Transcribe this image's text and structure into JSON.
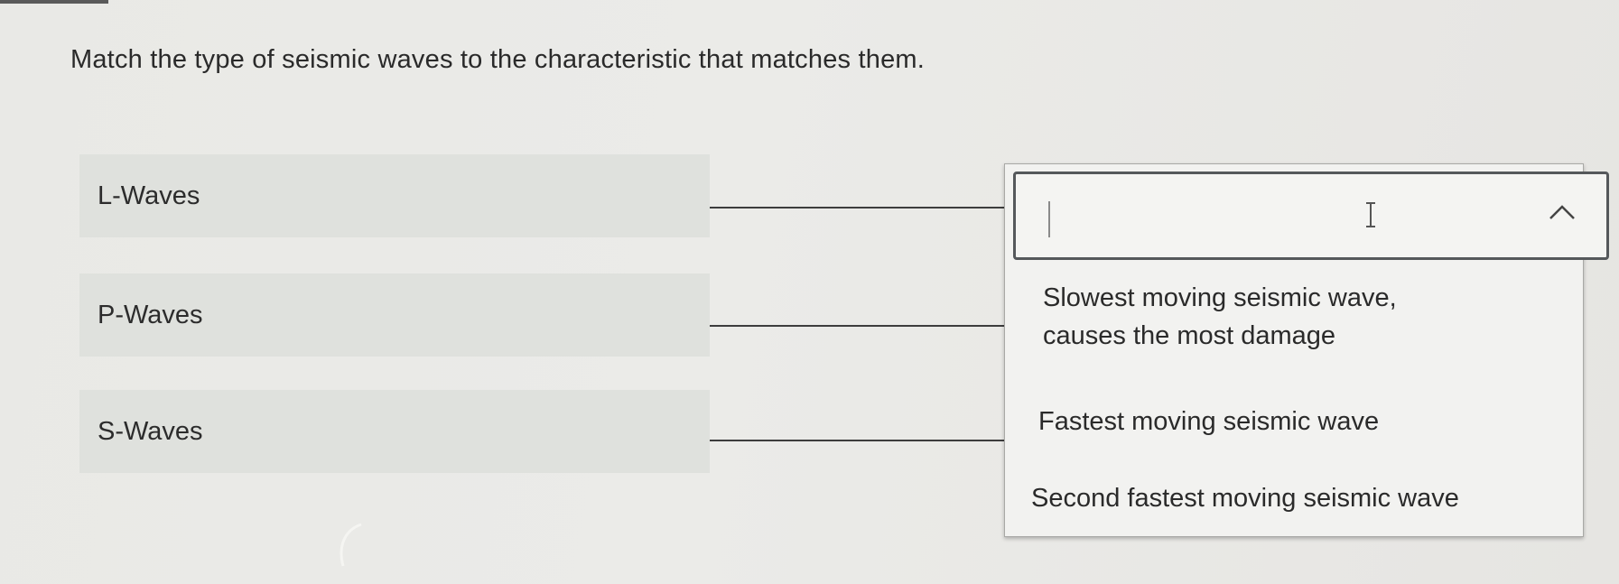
{
  "question": "Match the type of seismic waves to the characteristic that matches them.",
  "terms": [
    {
      "label": "L-Waves"
    },
    {
      "label": "P-Waves"
    },
    {
      "label": "S-Waves"
    }
  ],
  "dropdown": {
    "selected_value": "",
    "expanded": true,
    "icons": [
      "text-cursor-icon",
      "chevron-up-icon"
    ],
    "options": [
      {
        "line1": "Slowest moving seismic wave,",
        "line2": "causes the most damage"
      },
      {
        "line1": "Fastest moving seismic wave"
      },
      {
        "line1": "Second fastest moving seismic wave"
      }
    ]
  },
  "colors": {
    "background": "#e9e9e6",
    "term_background": "#dfe1dd",
    "dropdown_border": "#55585b",
    "panel_background": "#f2f2f0"
  }
}
